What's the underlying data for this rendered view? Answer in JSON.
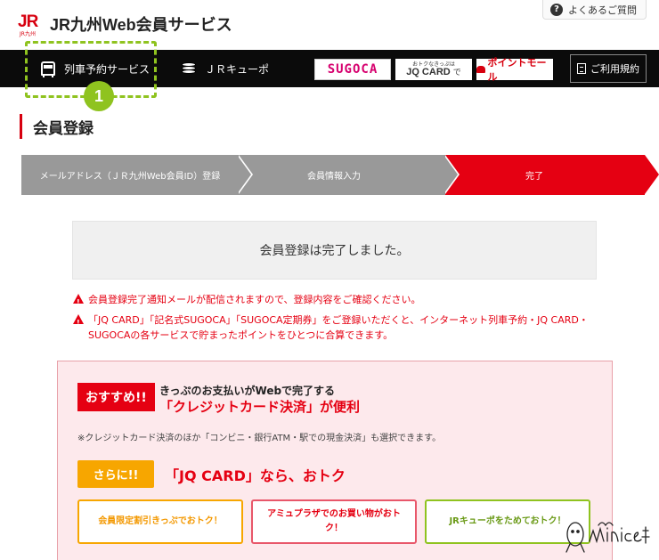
{
  "header": {
    "logo_mark": "JR",
    "logo_sub": "JR九州",
    "site_title": "JR九州Web会員サービス",
    "faq_icon": "?",
    "faq_label": "よくあるご質問"
  },
  "nav": {
    "items": [
      {
        "label": "列車予約サービス",
        "icon": "train-icon"
      },
      {
        "label": "ＪＲキューポ",
        "icon": "coins-icon"
      }
    ],
    "external": {
      "sugoca": "SUGOCA",
      "jqcard_small": "おトクなきっぷは",
      "jqcard_big": "JQ CARD",
      "jqcard_suffix": "で",
      "pointmall": "ポイントモール"
    },
    "terms_label": "ご利用規約"
  },
  "annotation": {
    "number": "1",
    "color": "#8fc31f"
  },
  "page": {
    "title": "会員登録",
    "steps": [
      "メールアドレス（ＪＲ九州Web会員ID）登録",
      "会員情報入力",
      "完了"
    ],
    "complete_message": "会員登録は完了しました。",
    "notices": [
      "会員登録完了通知メールが配信されますので、登録内容をご確認ください。",
      "「JQ CARD」「記名式SUGOCA」「SUGOCA定期券」をご登録いただくと、インターネット列車予約・JQ CARD・SUGOCAの各サービスで貯まったポイントをひとつに合算できます。"
    ]
  },
  "promo": {
    "osusume_label": "おすすめ!!",
    "line1": "きっぷのお支払いがWebで完了する",
    "line2": "「クレジットカード決済」が便利",
    "note": "※クレジットカード決済のほか「コンビニ・銀行ATM・駅での現金決済」も選択できます。",
    "sarani_label": "さらに!!",
    "jq_line": "「JQ CARD」なら、おトク",
    "buttons": [
      "会員限定割引きっぷでおトク！",
      "アミュプラザでのお買い物がおトク！",
      "JRキューポをためておトク！"
    ]
  },
  "colors": {
    "brand_red": "#e50012",
    "nav_bg": "#0b0b0b",
    "step_gray": "#999999",
    "promo_bg": "#fde9ec",
    "orange": "#f7a600",
    "green": "#8fc31f"
  }
}
